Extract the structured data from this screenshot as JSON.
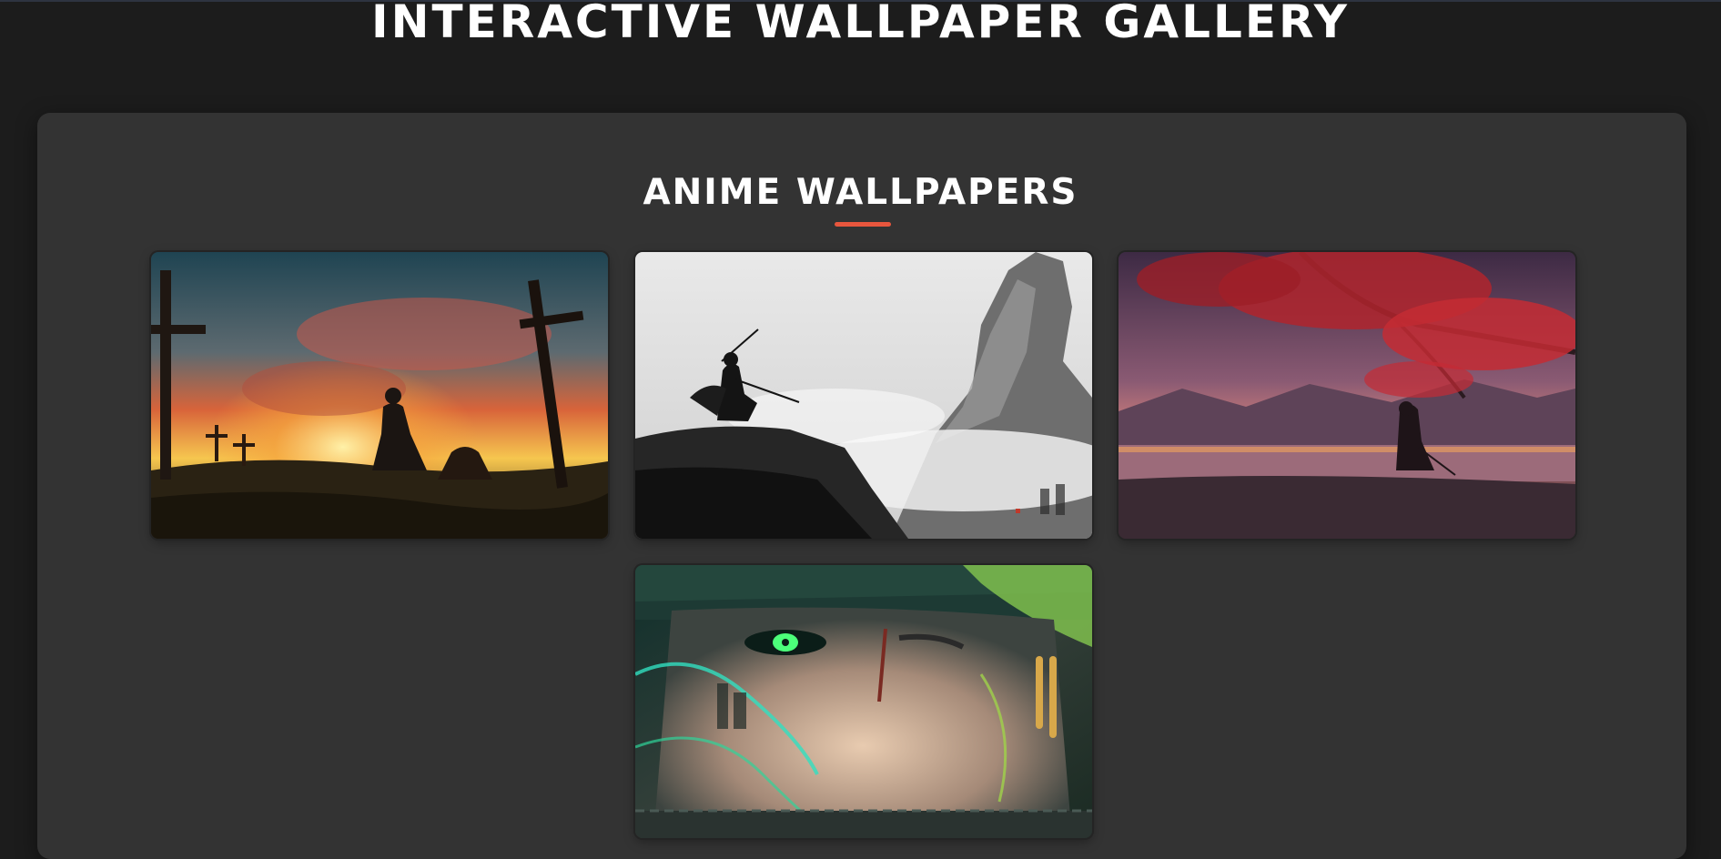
{
  "page": {
    "title": "INTERACTIVE WALLPAPER GALLERY"
  },
  "gallery": {
    "section_title": "ANIME WALLPAPERS",
    "accent_color": "#e8563d",
    "wallpapers": [
      {
        "subject": "knight-battlefield-sunset"
      },
      {
        "subject": "ink-samurai-mountain"
      },
      {
        "subject": "red-blossom-warrior-lake"
      },
      {
        "subject": "green-haired-swordsman-closeup"
      }
    ]
  }
}
